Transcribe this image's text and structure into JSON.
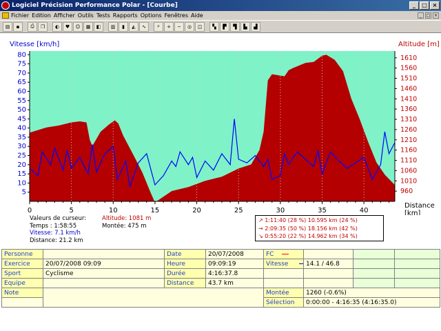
{
  "window": {
    "title": "Logiciel Précision Performance Polar - [Courbe]"
  },
  "menu": [
    "Fichier",
    "Edition",
    "Afficher",
    "Outils",
    "Tests",
    "Rapports",
    "Options",
    "Fenêtres",
    "Aide"
  ],
  "toolbar_icons": [
    "open-icon",
    "save-icon",
    "print-icon",
    "copy-icon",
    "sport-icon",
    "heart-icon",
    "profile-icon",
    "calendar-icon",
    "color-icon",
    "book-icon",
    "chart-bar-icon",
    "chart-area-icon",
    "chart-line-icon",
    "zoom-icon",
    "zoom-in-icon",
    "zoom-out-icon",
    "zoom-reset-icon",
    "lap-icon",
    "graph1-icon",
    "graph2-icon",
    "graph3-icon",
    "graph4-icon",
    "graph5-icon"
  ],
  "chart_data": {
    "type": "line",
    "left_axis_label": "Vitesse [km/h]",
    "right_axis_label": "Altitude [m]",
    "x_axis_label": "Distance [km]",
    "x_ticks": [
      0,
      5,
      10,
      15,
      20,
      25,
      30,
      35,
      40
    ],
    "y_left_ticks": [
      5,
      10,
      15,
      20,
      25,
      30,
      35,
      40,
      45,
      50,
      55,
      60,
      65,
      70,
      75,
      80
    ],
    "y_right_ticks": [
      960,
      1010,
      1060,
      1110,
      1160,
      1210,
      1260,
      1310,
      1360,
      1410,
      1460,
      1510,
      1560,
      1610
    ],
    "xlim": [
      0,
      43.7
    ],
    "ylim_left": [
      0,
      82
    ],
    "ylim_right": [
      910,
      1643
    ],
    "altitude": {
      "x": [
        0,
        2,
        3.5,
        5,
        6,
        6.8,
        7.2,
        7.5,
        8.5,
        9.5,
        10.2,
        10.6,
        11.2,
        12.5,
        13.5,
        14.5,
        15,
        17,
        19,
        21,
        23,
        25,
        26.5,
        27.5,
        28,
        28.5,
        29,
        30.5,
        31,
        31.5,
        33,
        34,
        35,
        35.5,
        36.5,
        37.5,
        38.5,
        39.5,
        40.5,
        41.5,
        42.5,
        43.7
      ],
      "values": [
        1245,
        1270,
        1280,
        1295,
        1300,
        1295,
        1210,
        1180,
        1250,
        1285,
        1305,
        1290,
        1230,
        1130,
        1050,
        950,
        905,
        960,
        980,
        1010,
        1030,
        1070,
        1090,
        1160,
        1250,
        1500,
        1530,
        1520,
        1550,
        1560,
        1585,
        1590,
        1620,
        1625,
        1600,
        1545,
        1410,
        1310,
        1200,
        1100,
        1040,
        990
      ]
    },
    "speed": {
      "x": [
        0,
        1,
        1.5,
        2.5,
        3,
        4,
        4.5,
        5,
        6,
        7,
        7.5,
        8,
        9,
        10,
        10.5,
        11.5,
        12,
        13,
        14,
        15,
        16,
        17,
        17.5,
        18,
        19,
        19.5,
        20,
        21,
        22,
        23,
        24,
        24.5,
        25,
        26,
        27,
        28,
        28.5,
        29,
        30,
        30.5,
        31,
        32,
        33,
        34,
        34.5,
        35,
        36,
        37,
        38,
        39,
        40,
        41,
        42,
        42.5,
        43,
        43.7
      ],
      "values": [
        18,
        14,
        27,
        20,
        29,
        17,
        28,
        18,
        24,
        15,
        31,
        16,
        26,
        30,
        12,
        22,
        8,
        21,
        26,
        9,
        14,
        22,
        19,
        27,
        20,
        24,
        13,
        22,
        17,
        26,
        20,
        45,
        23,
        21,
        25,
        19,
        23,
        12,
        14,
        26,
        20,
        27,
        23,
        19,
        28,
        15,
        27,
        22,
        18,
        21,
        24,
        12,
        20,
        38,
        26,
        32
      ]
    }
  },
  "cursor": {
    "header": "Valeurs de curseur:",
    "time": "Temps : 1:58:55",
    "speed": "Vitesse: 7.1 km/h",
    "distance": "Distance: 21.2 km",
    "altitude": "Altitude: 1081 m",
    "climb": "Montée: 475 m"
  },
  "stats": [
    {
      "arrow": "↗",
      "text": "1:11:40  (28 %) 10.595 km  (24 %)"
    },
    {
      "arrow": "→",
      "text": "2:09:35  (50 %) 18.156 km  (42 %)"
    },
    {
      "arrow": "↘",
      "text": "0:55:20  (22 %) 14.962 km  (34 %)"
    }
  ],
  "info": {
    "personne_label": "Personne",
    "exercice_label": "Exercice",
    "exercice_value": "20/07/2008 09:09",
    "sport_label": "Sport",
    "sport_value": "Cyclisme",
    "equipe_label": "Equipe",
    "note_label": "Note",
    "date_label": "Date",
    "date_value": "20/07/2008",
    "heure_label": "Heure",
    "heure_value": "09:09:19",
    "duree_label": "Durée",
    "duree_value": "4:16:37.8",
    "distance_label": "Distance",
    "distance_value": "43.7 km",
    "fc_label": "FC",
    "vitesse_label": "Vitesse",
    "vitesse_value": "14.1 / 46.8",
    "montee_label": "Montée",
    "montee_value": "1260 (-0.6%)",
    "selection_label": "Sélection",
    "selection_value": "0:00:00 - 4:16:35 (4:16:35.0)"
  },
  "colors": {
    "altitude_fill": "#b40000",
    "speed_line": "#0000ff",
    "plot_bg": "#7ff2c8",
    "left_axis": "#0000cc",
    "right_axis": "#c00000"
  }
}
